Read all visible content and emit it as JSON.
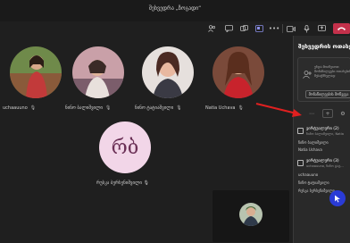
{
  "window": {
    "title": "შეხვედრა „ზოგადი“"
  },
  "toolbar": {
    "icons": [
      "people-icon",
      "chat-icon",
      "react-icon",
      "rooms-icon",
      "apps-icon",
      "more-icon",
      "camera-icon",
      "mic-icon",
      "share-icon"
    ],
    "leave_icon": "phone-hangup-icon"
  },
  "participants": [
    {
      "name": "uchaauuno",
      "mic": "🎙"
    },
    {
      "name": "ნინო ბალიშვილი",
      "mic": "🎙"
    },
    {
      "name": "ნინო ტატიაშვილი",
      "mic": "🎙"
    },
    {
      "name": "Natia Uchava",
      "mic": "🎙"
    }
  ],
  "initials_participant": {
    "initials": "რბ",
    "name": "რუსკა ბერსენიშვილი 🎙"
  },
  "panel": {
    "title": "შეხვედრის ოთახები",
    "invite_text": "უნდა მოიწვიოთ მონაწილეები ოთახების შესაქმნელად",
    "invite_button": "მონაწილეების მოწვევა",
    "rooms": [
      {
        "title": "ვირტუალური (2)",
        "sub": "ნინო ბალიშვილი, Natia"
      },
      {
        "title": "ვირტუალური (3)",
        "sub": "uchaauuno, ნინო ტატ..."
      }
    ],
    "members_room1": [
      "ნინო ბალიშვილი",
      "Natia Uchava"
    ],
    "members_room2": [
      "uchaauuno",
      "ნინო ტატიაშვილი",
      "რუსკა ბერსენიშვილი"
    ]
  },
  "colors": {
    "accent": "#8b8fe8",
    "leave": "#c4314b",
    "fab": "#2a3bd6",
    "arrow": "#e02020"
  }
}
